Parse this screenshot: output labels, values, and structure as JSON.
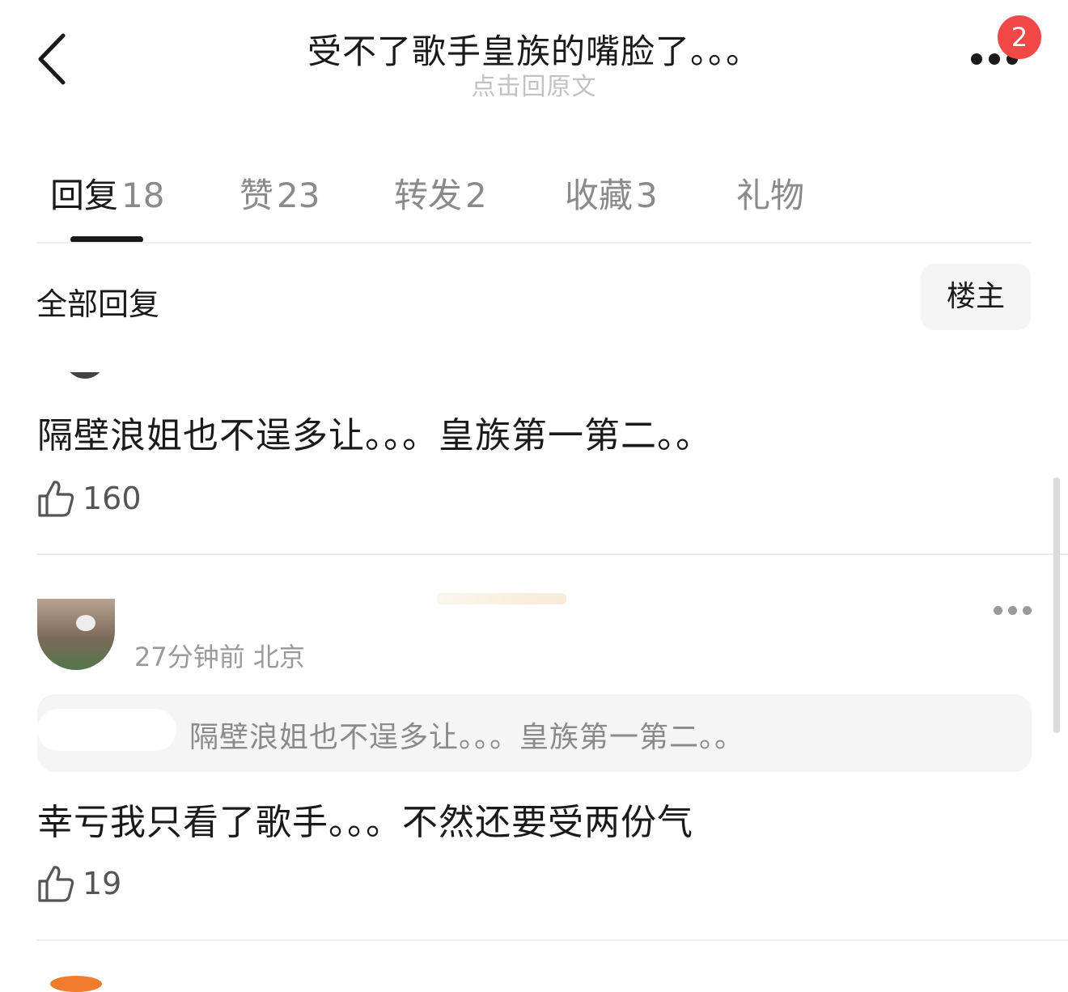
{
  "header": {
    "title": "受不了歌手皇族的嘴脸了。。。",
    "subtitle": "点击回原文",
    "notification_count": "2"
  },
  "tabs": [
    {
      "label": "回复",
      "count": "18"
    },
    {
      "label": "赞",
      "count": "23"
    },
    {
      "label": "转发",
      "count": "2"
    },
    {
      "label": "收藏",
      "count": "3"
    },
    {
      "label": "礼物",
      "count": ""
    }
  ],
  "section": {
    "title": "全部回复",
    "filter_label": "楼主"
  },
  "comments": [
    {
      "text": "隔壁浪姐也不逞多让。。。皇族第一第二。。",
      "likes": "160"
    },
    {
      "meta": "27分钟前 北京",
      "quote": "隔壁浪姐也不逞多让。。。皇族第一第二。。",
      "text": "幸亏我只看了歌手。。。不然还要受两份气",
      "likes": "19"
    }
  ],
  "icons": {
    "back": "chevron-left-icon",
    "more": "more-horizontal-icon",
    "like": "thumbs-up-icon"
  },
  "colors": {
    "badge": "#f24848",
    "text_primary": "#1a1a1a",
    "text_secondary": "#8a8a8a"
  }
}
